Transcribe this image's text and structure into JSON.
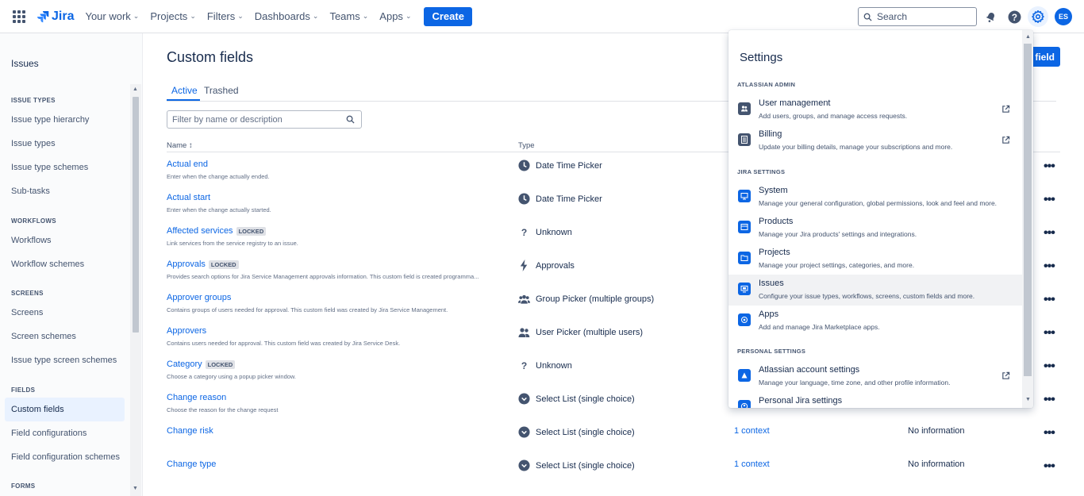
{
  "nav": {
    "logo": "Jira",
    "items": [
      "Your work",
      "Projects",
      "Filters",
      "Dashboards",
      "Teams",
      "Apps"
    ],
    "create": "Create",
    "search_placeholder": "Search",
    "avatar_initials": "ES"
  },
  "sidebar": {
    "title": "Issues",
    "sections": {
      "issue_types": "ISSUE TYPES",
      "workflows": "WORKFLOWS",
      "screens": "SCREENS",
      "fields": "FIELDS",
      "forms": "FORMS"
    },
    "items": {
      "issue_type_hierarchy": "Issue type hierarchy",
      "issue_types": "Issue types",
      "issue_type_schemes": "Issue type schemes",
      "sub_tasks": "Sub-tasks",
      "workflows": "Workflows",
      "workflow_schemes": "Workflow schemes",
      "screens": "Screens",
      "screen_schemes": "Screen schemes",
      "issue_type_screen_schemes": "Issue type screen schemes",
      "custom_fields": "Custom fields",
      "field_configurations": "Field configurations",
      "field_configuration_schemes": "Field configuration schemes"
    }
  },
  "main": {
    "title": "Custom fields",
    "add_button": "field",
    "tabs": {
      "active": "Active",
      "trashed": "Trashed"
    },
    "filter_placeholder": "Filter by name or description",
    "columns": {
      "name": "Name",
      "type": "Type"
    },
    "locked_label": "LOCKED",
    "rows": [
      {
        "name": "Actual end",
        "desc": "Enter when the change actually ended.",
        "type": "Date Time Picker",
        "icon": "clock-icon"
      },
      {
        "name": "Actual start",
        "desc": "Enter when the change actually started.",
        "type": "Date Time Picker",
        "icon": "clock-icon"
      },
      {
        "name": "Affected services",
        "locked": true,
        "desc": "Link services from the service registry to an issue.",
        "type": "Unknown",
        "icon": "question-icon"
      },
      {
        "name": "Approvals",
        "locked": true,
        "desc": "Provides search options for Jira Service Management approvals information. This custom field is created programma...",
        "type": "Approvals",
        "icon": "bolt-icon"
      },
      {
        "name": "Approver groups",
        "desc": "Contains groups of users needed for approval. This custom field was created by Jira Service Management.",
        "type": "Group Picker (multiple groups)",
        "icon": "group-icon"
      },
      {
        "name": "Approvers",
        "desc": "Contains users needed for approval. This custom field was created by Jira Service Desk.",
        "type": "User Picker (multiple users)",
        "icon": "users-icon"
      },
      {
        "name": "Category",
        "locked": true,
        "desc": "Choose a category using a popup picker window.",
        "type": "Unknown",
        "icon": "question-icon"
      },
      {
        "name": "Change reason",
        "desc": "Choose the reason for the change request",
        "type": "Select List (single choice)",
        "icon": "select-icon"
      },
      {
        "name": "Change risk",
        "desc": "",
        "type": "Select List (single choice)",
        "icon": "select-icon",
        "context": "1 context",
        "info": "No information"
      },
      {
        "name": "Change type",
        "desc": "",
        "type": "Select List (single choice)",
        "icon": "select-icon",
        "context": "1 context",
        "info": "No information"
      }
    ]
  },
  "settings": {
    "title": "Settings",
    "sections": {
      "atlassian_admin": "ATLASSIAN ADMIN",
      "jira_settings": "JIRA SETTINGS",
      "personal_settings": "PERSONAL SETTINGS"
    },
    "items": {
      "user_management": {
        "name": "User management",
        "desc": "Add users, groups, and manage access requests."
      },
      "billing": {
        "name": "Billing",
        "desc": "Update your billing details, manage your subscriptions and more."
      },
      "system": {
        "name": "System",
        "desc": "Manage your general configuration, global permissions, look and feel and more."
      },
      "products": {
        "name": "Products",
        "desc": "Manage your Jira products' settings and integrations."
      },
      "projects": {
        "name": "Projects",
        "desc": "Manage your project settings, categories, and more."
      },
      "issues": {
        "name": "Issues",
        "desc": "Configure your issue types, workflows, screens, custom fields and more."
      },
      "apps": {
        "name": "Apps",
        "desc": "Add and manage Jira Marketplace apps."
      },
      "atlassian_account": {
        "name": "Atlassian account settings",
        "desc": "Manage your language, time zone, and other profile information."
      },
      "personal_jira": {
        "name": "Personal Jira settings",
        "desc": ""
      }
    }
  }
}
